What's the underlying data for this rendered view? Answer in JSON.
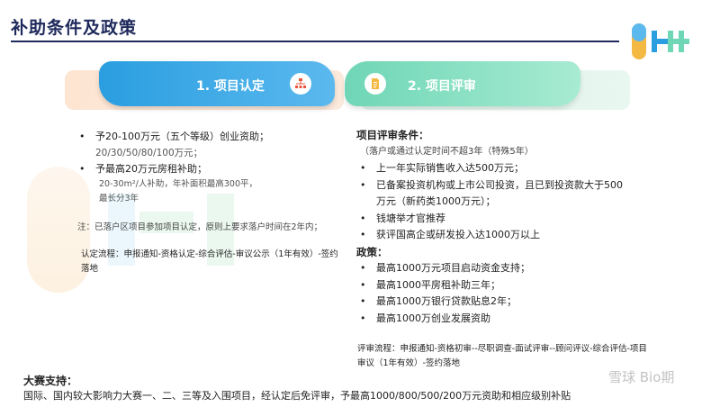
{
  "title": "补助条件及政策",
  "steps": [
    {
      "label": "1. 项目认定",
      "icon": "org-chart-icon"
    },
    {
      "label": "2.  项目评审",
      "icon": "document-icon"
    }
  ],
  "left": {
    "bullet1": "予20-100万元（五个等级）创业资助；",
    "bullet1_sub": "20/30/50/80/100万元；",
    "bullet2": "予最高20万元房租补助；",
    "bullet2_sub1": "20-30m²/人补助，年补面积最高300平，",
    "bullet2_sub2": "最长分3年",
    "note": "注：已落户区项目参加项目认定，原则上要求落户时间在2年内；",
    "flow": "认定流程：申报通知-资格认定-综合评估-审议公示（1年有效）-签约落地"
  },
  "right": {
    "cond_heading": "项目评审条件：",
    "cond_note": "（落户或通过认定时间不超3年（特殊5年）",
    "conditions": [
      "上一年实际销售收入达500万元；",
      "已备案投资机构或上市公司投资，且已到投资款大于500万元（新药类1000万元）；",
      "钱塘举才官推荐",
      "获评国高企或研发投入达1000万以上"
    ],
    "policy_heading": "政策：",
    "policies": [
      "最高1000万元项目启动资金支持；",
      "最高1000平房租补助三年；",
      "最高1000万银行贷款贴息2年；",
      "最高1000万创业发展资助"
    ],
    "flow": "评审流程：申报通知-资格初审--尽职调查-面试评审--顾问评议-综合评估-项目审议（1年有效）-签约落地"
  },
  "contest": {
    "heading": "大赛支持：",
    "text": "国际、国内较大影响力大赛一、二、三等及入围项目，经认定后免评审，予最高1000/800/500/200万元资助和相应级别补贴"
  },
  "watermark": "雪球 Bio期",
  "colors": {
    "navy": "#1f2a5c",
    "blue": "#2a9ee0",
    "green": "#6fd6b6"
  }
}
